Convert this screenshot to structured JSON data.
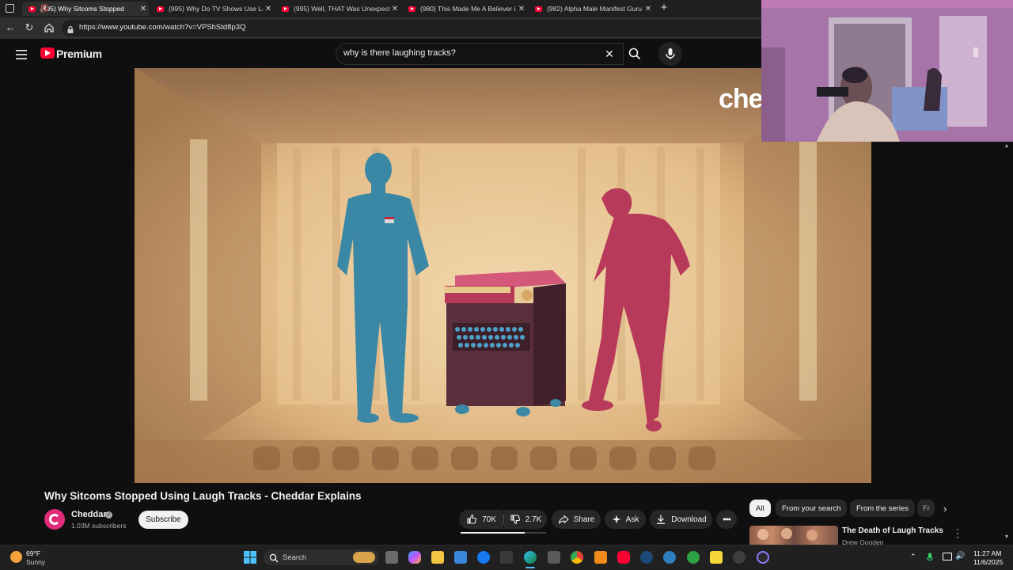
{
  "browser": {
    "tabs": [
      {
        "title": "(995) Why Sitcoms Stopped",
        "active": true,
        "muted": true
      },
      {
        "title": "(995) Why Do TV Shows Use Laug",
        "active": false
      },
      {
        "title": "(995) Well, THAT Was Unexpected",
        "active": false
      },
      {
        "title": "(980) This Made Me A Believer in",
        "active": false
      },
      {
        "title": "(982) Alpha Male Manifest Guru F",
        "active": false
      }
    ],
    "new_tab_symbol": "+",
    "url": "https://www.youtube.com/watch?v=VPShStd8p3Q"
  },
  "youtube": {
    "logo_text": "Premium",
    "search_query": "why is there laughing tracks?",
    "video": {
      "overlay_text": "che",
      "title": "Why Sitcoms Stopped Using Laugh Tracks - Cheddar Explains",
      "channel": "Cheddar",
      "subscribers": "1.03M subscribers",
      "subscribe_label": "Subscribe",
      "likes": "70K",
      "dislikes": "2.7K",
      "share_label": "Share",
      "ask_label": "Ask",
      "download_label": "Download"
    },
    "chips": [
      "All",
      "From your search",
      "From the series",
      "Fr"
    ],
    "recommendation": {
      "title": "The Death of Laugh Tracks",
      "channel": "Drew Gooden"
    }
  },
  "taskbar": {
    "weather_temp": "69°F",
    "weather_desc": "Sunny",
    "search_label": "Search",
    "time": "11:27 AM",
    "date": "11/6/2025"
  },
  "colors": {
    "youtube_red": "#ff0033",
    "blue_figure": "#3b87a6",
    "red_figure": "#b83a5a",
    "machine": "#5a2f3c"
  }
}
